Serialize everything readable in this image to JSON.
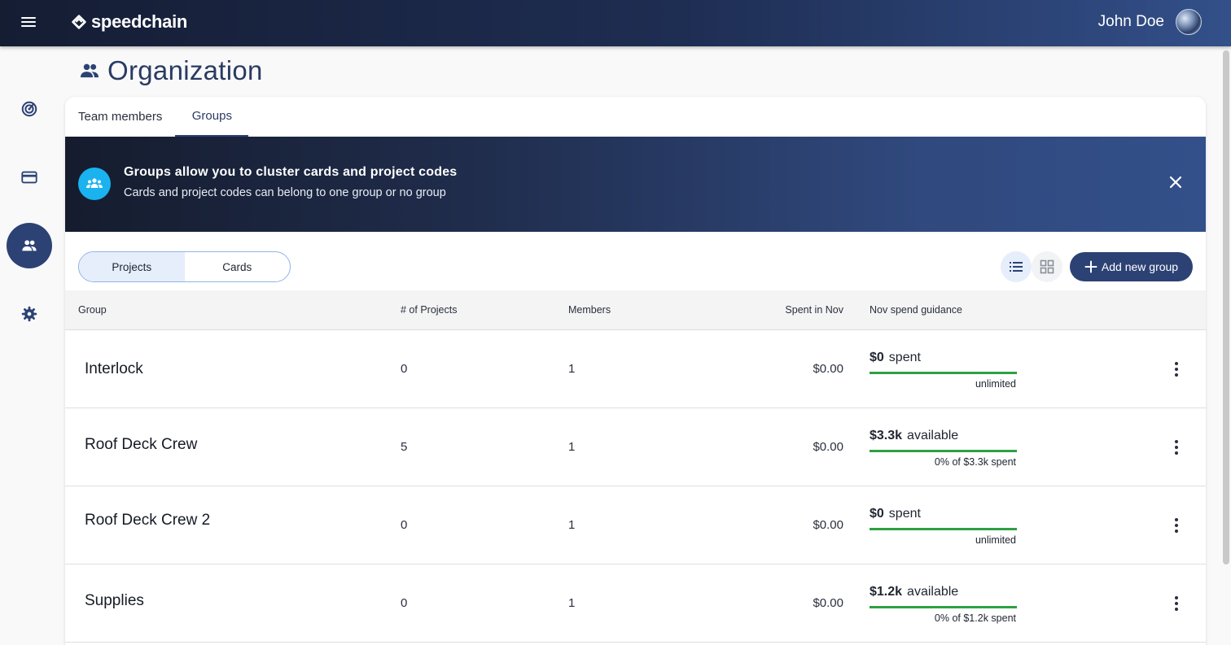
{
  "header": {
    "brand": "speedchain",
    "user_name": "John Doe"
  },
  "sidebar": {
    "items": [
      {
        "name": "dashboard",
        "icon": "radar-icon"
      },
      {
        "name": "cards",
        "icon": "credit-card-icon"
      },
      {
        "name": "organization",
        "icon": "people-icon",
        "active": true
      },
      {
        "name": "settings",
        "icon": "gear-icon"
      }
    ]
  },
  "page": {
    "title": "Organization"
  },
  "tabs": [
    {
      "label": "Team members"
    },
    {
      "label": "Groups",
      "active": true
    }
  ],
  "banner": {
    "title": "Groups allow you to cluster cards and project codes",
    "subtitle": "Cards and project codes can belong to one group or no group"
  },
  "toolbar": {
    "toggle": [
      {
        "label": "Projects",
        "active": true
      },
      {
        "label": "Cards"
      }
    ],
    "add_label": "Add new group"
  },
  "table": {
    "headers": [
      "Group",
      "# of Projects",
      "Members",
      "Spent in Nov",
      "Nov spend guidance"
    ],
    "rows": [
      {
        "name": "Interlock",
        "projects": "0",
        "members": "1",
        "spent": "$0.00",
        "guidance_amount": "$0",
        "guidance_label": "spent",
        "guidance_sub": "unlimited"
      },
      {
        "name": "Roof Deck Crew",
        "projects": "5",
        "members": "1",
        "spent": "$0.00",
        "guidance_amount": "$3.3k",
        "guidance_label": "available",
        "guidance_sub": "0% of $3.3k spent"
      },
      {
        "name": "Roof Deck Crew 2",
        "projects": "0",
        "members": "1",
        "spent": "$0.00",
        "guidance_amount": "$0",
        "guidance_label": "spent",
        "guidance_sub": "unlimited"
      },
      {
        "name": "Supplies",
        "projects": "0",
        "members": "1",
        "spent": "$0.00",
        "guidance_amount": "$1.2k",
        "guidance_label": "available",
        "guidance_sub": "0% of $1.2k spent"
      }
    ]
  },
  "colors": {
    "primary": "#2c4274",
    "accent": "#1ab3f0",
    "progress": "#2ea043"
  }
}
